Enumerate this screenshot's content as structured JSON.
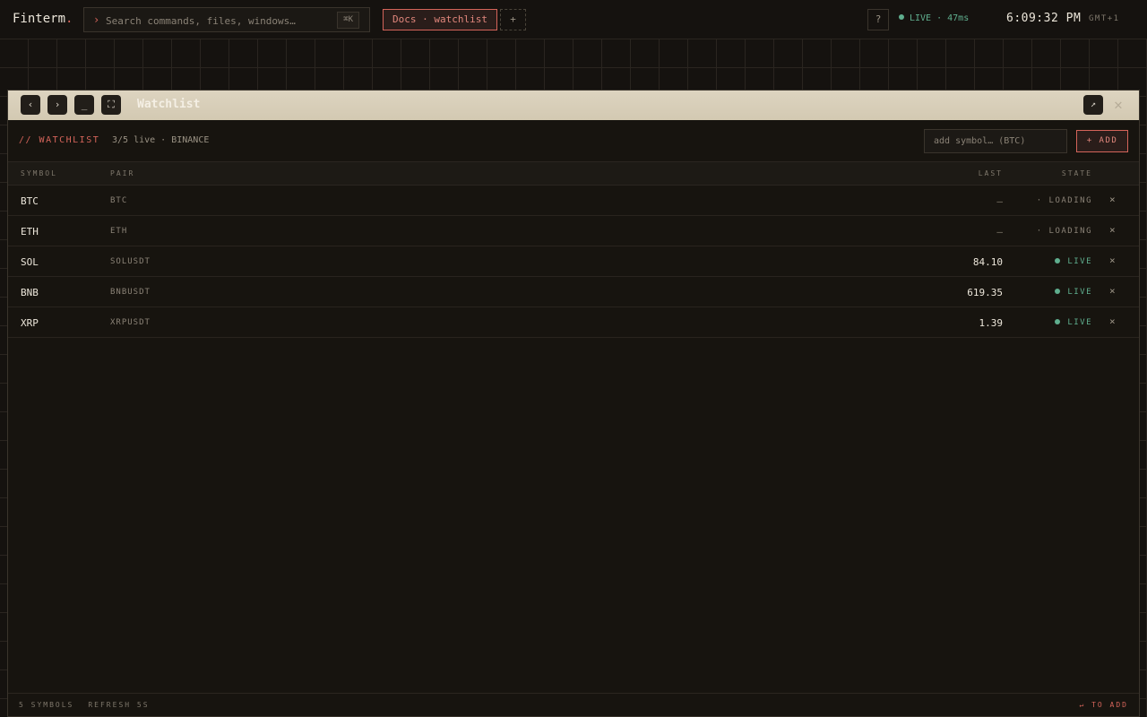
{
  "app": {
    "brand": "Finterm",
    "brand_dot": "."
  },
  "search": {
    "caret": "›",
    "placeholder": "Search commands, files, windows…",
    "shortcut": "⌘K"
  },
  "tabs": {
    "active_label": "Docs · watchlist",
    "add_label": "+"
  },
  "status": {
    "help_label": "?",
    "live_text": "LIVE · 47ms",
    "clock": "6:09:32 PM",
    "timezone": "GMT+1"
  },
  "window": {
    "title": "Watchlist",
    "back_icon": "‹",
    "forward_icon": "›",
    "minimize_icon": "_",
    "maximize_icon": "⛶",
    "popout_icon": "↗",
    "close_icon": "✕"
  },
  "watchlist": {
    "label": "// WATCHLIST",
    "meta": "3/5 live · BINANCE",
    "add_placeholder": "add symbol… (BTC)",
    "add_button": "+ ADD",
    "columns": {
      "symbol": "SYMBOL",
      "pair": "PAIR",
      "last": "LAST",
      "state": "STATE"
    },
    "rows": [
      {
        "symbol": "BTC",
        "pair": "BTC",
        "last": "—",
        "state": "· LOADING",
        "remove": "×"
      },
      {
        "symbol": "ETH",
        "pair": "ETH",
        "last": "—",
        "state": "· LOADING",
        "remove": "×"
      },
      {
        "symbol": "SOL",
        "pair": "SOLUSDT",
        "last": "84.10",
        "state": "LIVE",
        "remove": "×"
      },
      {
        "symbol": "BNB",
        "pair": "BNBUSDT",
        "last": "619.35",
        "state": "LIVE",
        "remove": "×"
      },
      {
        "symbol": "XRP",
        "pair": "XRPUSDT",
        "last": "1.39",
        "state": "LIVE",
        "remove": "×"
      }
    ]
  },
  "footer": {
    "symbols_count": "5 SYMBOLS",
    "refresh": "REFRESH 5S",
    "hint": "↵ TO ADD"
  },
  "colors": {
    "accent": "#d4645a",
    "live": "#5fae8e",
    "background": "#15120f",
    "titlebar": "#d8cfba"
  }
}
